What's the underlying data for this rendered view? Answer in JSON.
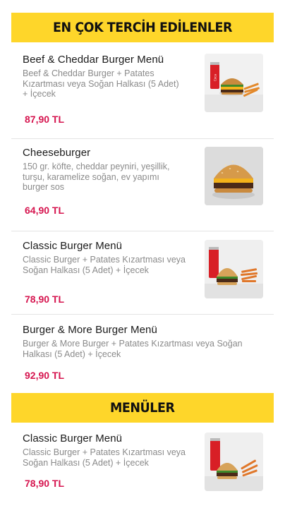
{
  "sections": [
    {
      "title": "EN ÇOK TERCİH EDİLENLER"
    },
    {
      "title": "MENÜLER"
    }
  ],
  "products": [
    {
      "name": "Beef & Cheddar Burger Menü",
      "desc": "Beef & Cheddar Burger + Patates Kızartması veya Soğan Halkası (5 Adet) + İçecek",
      "price": "87,90 TL"
    },
    {
      "name": "Cheeseburger",
      "desc": "150 gr. köfte, cheddar peyniri, yeşillik, turşu, karamelize soğan, ev yapımı burger sos",
      "price": "64,90 TL"
    },
    {
      "name": "Classic Burger Menü",
      "desc": "Classic Burger + Patates Kızartması veya Soğan Halkası (5 Adet) + İçecek",
      "price": "78,90 TL"
    },
    {
      "name": "Burger & More Burger Menü",
      "desc": "Burger & More Burger + Patates Kızartması veya Soğan Halkası (5 Adet) + İçecek",
      "price": "92,90 TL"
    },
    {
      "name": "Classic Burger Menü",
      "desc": "Classic Burger + Patates Kızartması veya Soğan Halkası (5 Adet) + İçecek",
      "price": "78,90 TL"
    }
  ],
  "colors": {
    "accent": "#fed62a",
    "price": "#d6154f",
    "muted": "#8a8a8a"
  },
  "icons": [
    "burger-menu-photo",
    "cheeseburger-photo",
    "burger-menu-photo",
    "burger-menu-photo"
  ]
}
